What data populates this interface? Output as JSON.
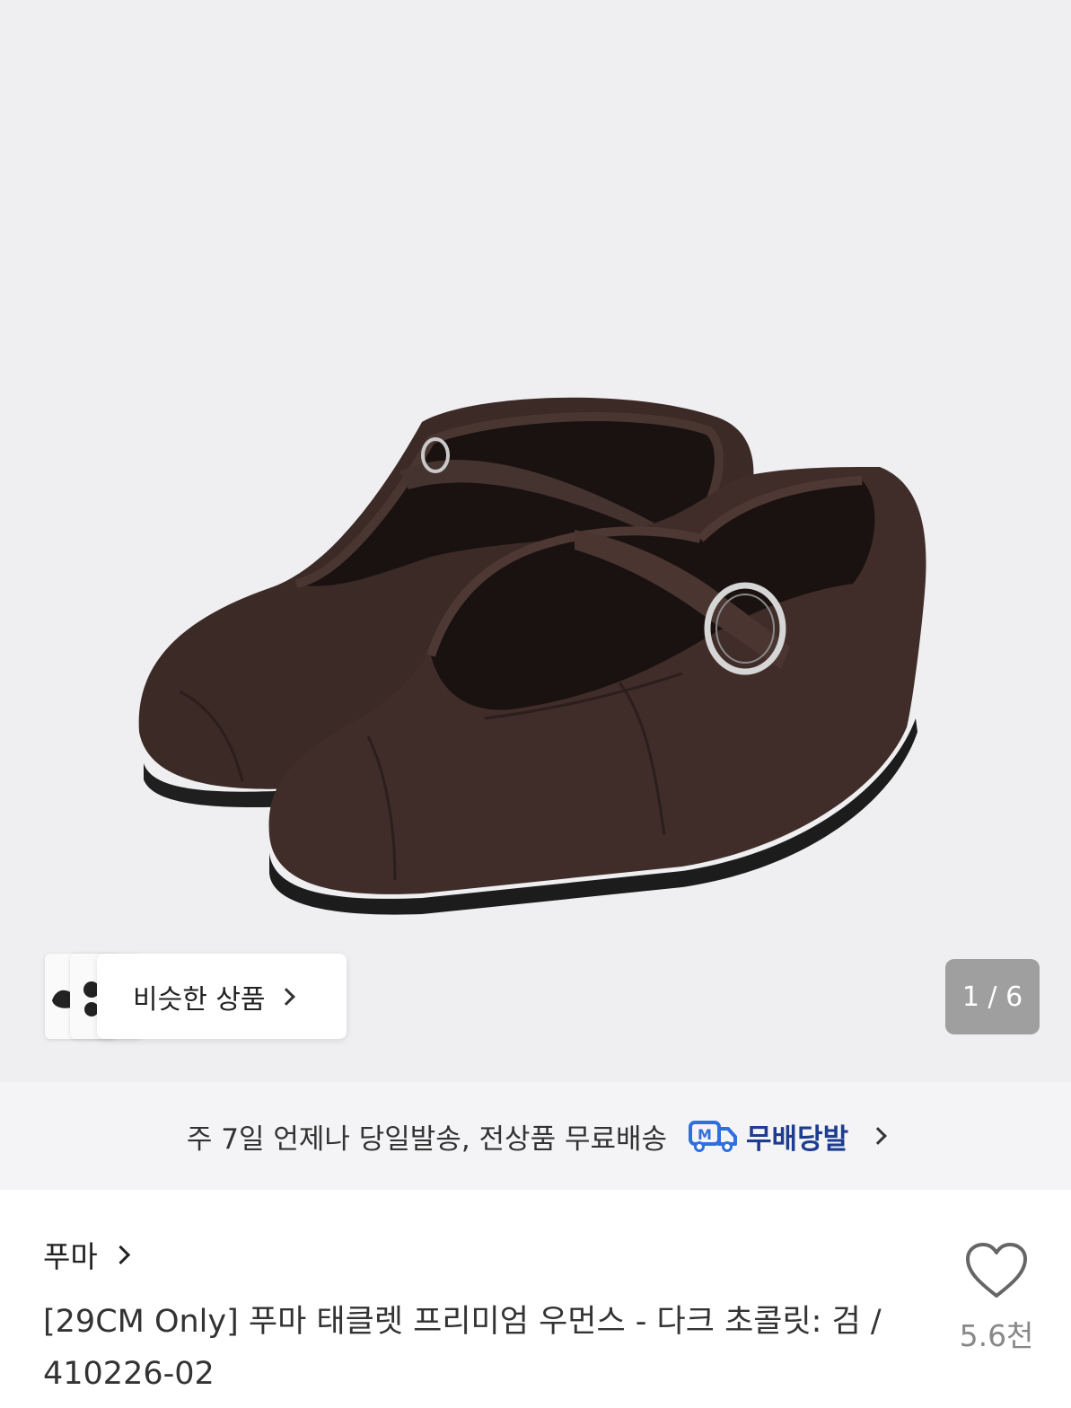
{
  "gallery": {
    "similar_label": "비슷한 상품",
    "pager": "1 / 6"
  },
  "shipping": {
    "text": "주 7일 언제나 당일발송, 전상품 무료배송",
    "badge_label": "무배당발",
    "badge_icon": "m-truck-icon",
    "badge_color": "#1e3d8f"
  },
  "product": {
    "brand": "푸마",
    "title": "[29CM Only] 푸마 태클렛 프리미엄 우먼스 - 다크 초콜릿: 검 / 410226-02",
    "like_count": "5.6천",
    "like_icon": "heart-outline-icon"
  }
}
